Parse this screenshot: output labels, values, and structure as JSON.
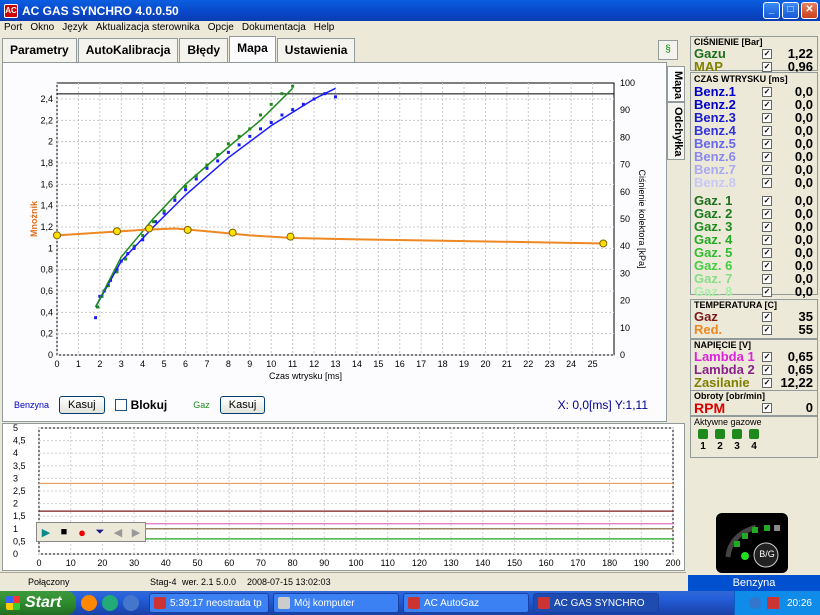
{
  "window": {
    "title": "AC GAS SYNCHRO  4.0.0.50"
  },
  "menu": [
    "Port",
    "Okno",
    "Język",
    "Aktualizacja sterownika",
    "Opcje",
    "Dokumentacja",
    "Help"
  ],
  "tabs": [
    "Parametry",
    "AutoKalibracja",
    "Błędy",
    "Mapa",
    "Ustawienia"
  ],
  "side_tabs": [
    "Mapa",
    "Odchyłka"
  ],
  "controls": {
    "benzyna": "Benzyna",
    "kasuj1": "Kasuj",
    "blokuj": "Blokuj",
    "gaz": "Gaz",
    "kasuj2": "Kasuj",
    "cursor_x_label": "X:",
    "cursor_x": "0,0",
    "cursor_x_unit": "[ms]",
    "cursor_y_label": "Y:",
    "cursor_y": "1,11"
  },
  "chart_data": [
    {
      "type": "scatter",
      "title": "",
      "xlabel": "Czas wtrysku [ms]",
      "ylabel": "Mnożnik",
      "y2label": "Ciśnienie kolektora [kPa]",
      "xlim": [
        0,
        26
      ],
      "ylim": [
        0,
        2.55
      ],
      "y2lim": [
        0,
        100
      ],
      "xticks": [
        0,
        1,
        2,
        3,
        4,
        5,
        6,
        7,
        8,
        9,
        10,
        11,
        12,
        13,
        14,
        15,
        16,
        17,
        18,
        19,
        20,
        21,
        22,
        23,
        24,
        25
      ],
      "yticks": [
        0,
        0.2,
        0.4,
        0.6,
        0.8,
        1,
        1.2,
        1.4,
        1.6,
        1.8,
        2,
        2.2,
        2.4
      ],
      "y2ticks": [
        0,
        10,
        20,
        30,
        40,
        50,
        60,
        70,
        80,
        90,
        100
      ],
      "reference_line_y2": 96,
      "series": [
        {
          "color": "#1a1aff",
          "points": [
            [
              1.8,
              0.35
            ],
            [
              1.9,
              0.45
            ],
            [
              2.0,
              0.55
            ],
            [
              2.2,
              0.6
            ],
            [
              2.5,
              0.7
            ],
            [
              2.8,
              0.8
            ],
            [
              3.0,
              0.88
            ],
            [
              3.3,
              0.95
            ],
            [
              3.6,
              1.0
            ],
            [
              4.0,
              1.08
            ],
            [
              4.3,
              1.18
            ],
            [
              4.6,
              1.25
            ],
            [
              5.0,
              1.33
            ],
            [
              5.5,
              1.45
            ],
            [
              6.0,
              1.55
            ],
            [
              6.5,
              1.65
            ],
            [
              7.0,
              1.75
            ],
            [
              7.5,
              1.82
            ],
            [
              8.0,
              1.9
            ],
            [
              8.5,
              1.97
            ],
            [
              9.0,
              2.05
            ],
            [
              9.5,
              2.12
            ],
            [
              10.0,
              2.18
            ],
            [
              10.5,
              2.25
            ],
            [
              11.0,
              2.3
            ],
            [
              11.5,
              2.35
            ],
            [
              12.0,
              2.4
            ],
            [
              12.5,
              2.45
            ],
            [
              13.0,
              2.42
            ]
          ]
        },
        {
          "color": "#1e8a1e",
          "points": [
            [
              1.9,
              0.45
            ],
            [
              2.1,
              0.55
            ],
            [
              2.4,
              0.65
            ],
            [
              2.8,
              0.78
            ],
            [
              3.2,
              0.9
            ],
            [
              3.6,
              1.02
            ],
            [
              4.0,
              1.12
            ],
            [
              4.5,
              1.25
            ],
            [
              5.0,
              1.35
            ],
            [
              5.5,
              1.48
            ],
            [
              6.0,
              1.58
            ],
            [
              6.5,
              1.68
            ],
            [
              7.0,
              1.78
            ],
            [
              7.5,
              1.88
            ],
            [
              8.0,
              1.98
            ],
            [
              8.5,
              2.05
            ],
            [
              9.0,
              2.12
            ],
            [
              9.5,
              2.25
            ],
            [
              10.0,
              2.35
            ],
            [
              10.5,
              2.45
            ],
            [
              11.0,
              2.52
            ]
          ]
        }
      ],
      "fit_lines": [
        {
          "color": "#1a1aff",
          "points": [
            [
              1.8,
              0.45
            ],
            [
              3,
              0.88
            ],
            [
              4.5,
              1.2
            ],
            [
              6,
              1.5
            ],
            [
              8,
              1.85
            ],
            [
              10,
              2.15
            ],
            [
              12,
              2.4
            ],
            [
              13,
              2.5
            ]
          ]
        },
        {
          "color": "#1e8a1e",
          "points": [
            [
              1.8,
              0.45
            ],
            [
              3,
              0.92
            ],
            [
              4.5,
              1.28
            ],
            [
              6,
              1.6
            ],
            [
              8,
              1.95
            ],
            [
              9.5,
              2.2
            ],
            [
              11,
              2.5
            ]
          ]
        }
      ],
      "pressure_curve": {
        "color": "#ee8822",
        "points": [
          [
            0,
            44
          ],
          [
            2,
            45
          ],
          [
            4,
            46
          ],
          [
            5.5,
            46.5
          ],
          [
            7,
            45.5
          ],
          [
            9,
            44
          ],
          [
            11,
            43
          ],
          [
            14,
            42.5
          ],
          [
            18,
            42
          ],
          [
            22,
            41.5
          ],
          [
            25.5,
            41
          ]
        ]
      },
      "pressure_markers": [
        [
          0,
          44
        ],
        [
          2.8,
          45.5
        ],
        [
          4.3,
          46.5
        ],
        [
          6.1,
          46
        ],
        [
          8.2,
          45
        ],
        [
          10.9,
          43.5
        ],
        [
          25.5,
          41
        ]
      ]
    },
    {
      "type": "line",
      "xlim": [
        0,
        200
      ],
      "ylim": [
        0,
        5
      ],
      "xticks": [
        0,
        10,
        20,
        30,
        40,
        50,
        60,
        70,
        80,
        90,
        100,
        110,
        120,
        130,
        140,
        150,
        160,
        170,
        180,
        190,
        200
      ],
      "yticks": [
        0,
        0.5,
        1,
        1.5,
        2,
        2.5,
        3,
        3.5,
        4,
        4.5,
        5
      ],
      "series": [
        {
          "color": "#e8a060",
          "values_y": 2.8
        },
        {
          "color": "#7a1a1a",
          "values_y": 1.7
        },
        {
          "color": "#e070c0",
          "values_y": 1.2
        },
        {
          "color": "#806030",
          "values_y": 1.0
        },
        {
          "color": "#20a020",
          "values_y": 0.6
        }
      ]
    }
  ],
  "playback": [
    "play",
    "stop",
    "record",
    "eject",
    "prev",
    "next"
  ],
  "status": {
    "connection": "Połączony",
    "stag": "Stag-4",
    "version": "wer. 2.1  5.0.0",
    "datetime": "2008-07-15 13:02:03",
    "mode": "Benzyna"
  },
  "pressure": {
    "header": "CIŚNIENIE [Bar]",
    "rows": [
      {
        "label": "Gazu",
        "value": "1,22",
        "color": "#1e6e1e"
      },
      {
        "label": "MAP",
        "value": "0,96",
        "color": "#808000"
      }
    ]
  },
  "injection": {
    "header": "CZAS WTRYSKU [ms]",
    "benz": [
      {
        "label": "Benz.1",
        "value": "0,0",
        "color": "#0000cc"
      },
      {
        "label": "Benz.2",
        "value": "0,0",
        "color": "#0000cc"
      },
      {
        "label": "Benz.3",
        "value": "0,0",
        "color": "#1a1acc"
      },
      {
        "label": "Benz.4",
        "value": "0,0",
        "color": "#3333dd"
      },
      {
        "label": "Benz.5",
        "value": "0,0",
        "color": "#6666ee"
      },
      {
        "label": "Benz.6",
        "value": "0,0",
        "color": "#8888ee"
      },
      {
        "label": "Benz.7",
        "value": "0,0",
        "color": "#aaaaf0"
      },
      {
        "label": "Benz.8",
        "value": "0,0",
        "color": "#c8c8f6"
      }
    ],
    "gaz": [
      {
        "label": "Gaz. 1",
        "value": "0,0",
        "color": "#1e6e1e"
      },
      {
        "label": "Gaz. 2",
        "value": "0,0",
        "color": "#1e7a1e"
      },
      {
        "label": "Gaz. 3",
        "value": "0,0",
        "color": "#1e8a1e"
      },
      {
        "label": "Gaz. 4",
        "value": "0,0",
        "color": "#22aa22"
      },
      {
        "label": "Gaz. 5",
        "value": "0,0",
        "color": "#33bb33"
      },
      {
        "label": "Gaz. 6",
        "value": "0,0",
        "color": "#44cc44"
      },
      {
        "label": "Gaz. 7",
        "value": "0,0",
        "color": "#88dd88"
      },
      {
        "label": "Gaz. 8",
        "value": "0,0",
        "color": "#aaeeaa"
      }
    ]
  },
  "temperature": {
    "header": "TEMPERATURA  [C]",
    "rows": [
      {
        "label": "Gaz",
        "value": "35",
        "color": "#7a1a1a"
      },
      {
        "label": "Red.",
        "value": "55",
        "color": "#ee8822"
      }
    ]
  },
  "voltage": {
    "header": "NAPIĘCIE [V]",
    "rows": [
      {
        "label": "Lambda 1",
        "value": "0,65",
        "color": "#dd22dd"
      },
      {
        "label": "Lambda 2",
        "value": "0,65",
        "color": "#882288"
      },
      {
        "label": "Zasilanie",
        "value": "12,22",
        "color": "#808000"
      }
    ]
  },
  "rpm": {
    "header": "Obroty [obr/min]",
    "label": "RPM",
    "value": "0",
    "color": "#dd0000"
  },
  "active": {
    "header": "Aktywne gazowe",
    "items": [
      "1",
      "2",
      "3",
      "4"
    ],
    "switch_label": "B/G"
  },
  "taskbar": {
    "start": "Start",
    "tasks": [
      "5:39:17 neostrada tp",
      "Mój komputer",
      "AC AutoGaz",
      "AC GAS SYNCHRO"
    ],
    "clock": "20:26"
  }
}
